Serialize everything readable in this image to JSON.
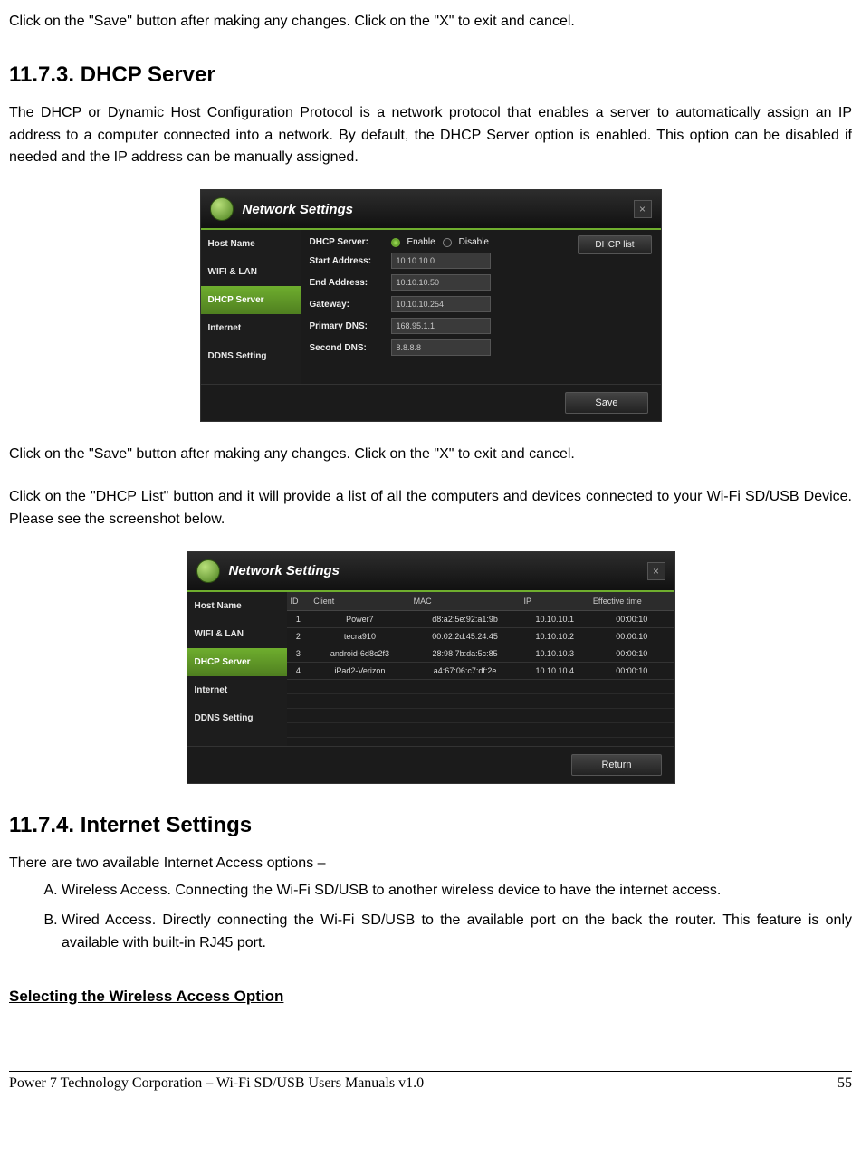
{
  "intro_para": "Click on the \"Save\" button after making any changes.    Click on the \"X\" to exit and cancel.",
  "section1173": {
    "heading": "11.7.3. DHCP Server",
    "desc": "The DHCP or Dynamic Host Configuration Protocol is a network protocol that enables a server to automatically assign an IP address to a computer connected into a network.    By default, the DHCP Server option is enabled.    This option can be disabled if needed and the IP address can be manually assigned."
  },
  "panel1": {
    "title": "Network Settings",
    "close_label": "×",
    "sidebar": [
      "Host Name",
      "WIFI & LAN",
      "DHCP Server",
      "Internet",
      "DDNS Setting"
    ],
    "active_index": 2,
    "dhcp_list_btn": "DHCP list",
    "save_btn": "Save",
    "fields": {
      "dhcp_server_label": "DHCP Server:",
      "enable_label": "Enable",
      "disable_label": "Disable",
      "start_label": "Start Address:",
      "start_val": "10.10.10.0",
      "end_label": "End Address:",
      "end_val": "10.10.10.50",
      "gw_label": "Gateway:",
      "gw_val": "10.10.10.254",
      "pdns_label": "Primary DNS:",
      "pdns_val": "168.95.1.1",
      "sdns_label": "Second DNS:",
      "sdns_val": "8.8.8.8"
    }
  },
  "mid_para1": "Click on the \"Save\" button after making any changes.    Click on the \"X\" to exit and cancel.",
  "mid_para2": "Click on the \"DHCP List\" button and it will provide a list of all the computers and devices connected to your Wi-Fi SD/USB Device.    Please see the screenshot below.",
  "panel2": {
    "title": "Network Settings",
    "close_label": "×",
    "sidebar": [
      "Host Name",
      "WIFI & LAN",
      "DHCP Server",
      "Internet",
      "DDNS Setting"
    ],
    "active_index": 2,
    "return_btn": "Return",
    "table": {
      "headers": [
        "ID",
        "Client",
        "MAC",
        "IP",
        "Effective time"
      ],
      "rows": [
        {
          "id": "1",
          "client": "Power7",
          "mac": "d8:a2:5e:92:a1:9b",
          "ip": "10.10.10.1",
          "time": "00:00:10"
        },
        {
          "id": "2",
          "client": "tecra910",
          "mac": "00:02:2d:45:24:45",
          "ip": "10.10.10.2",
          "time": "00:00:10"
        },
        {
          "id": "3",
          "client": "android-6d8c2f3",
          "mac": "28:98:7b:da:5c:85",
          "ip": "10.10.10.3",
          "time": "00:00:10"
        },
        {
          "id": "4",
          "client": "iPad2-Verizon",
          "mac": "a4:67:06:c7:df:2e",
          "ip": "10.10.10.4",
          "time": "00:00:10"
        }
      ]
    }
  },
  "section1174": {
    "heading": "11.7.4. Internet Settings",
    "intro": "There are two available Internet Access options –",
    "items": [
      "Wireless Access.   Connecting the Wi-Fi SD/USB to another wireless device to have the internet access.",
      "Wired Access. Directly connecting the Wi-Fi SD/USB to the available port on the back the router. This feature is only available with built-in RJ45 port."
    ],
    "sub": "Selecting the Wireless Access Option"
  },
  "footer": {
    "left": "Power 7 Technology Corporation – Wi-Fi SD/USB Users Manuals v1.0",
    "right": "55"
  }
}
